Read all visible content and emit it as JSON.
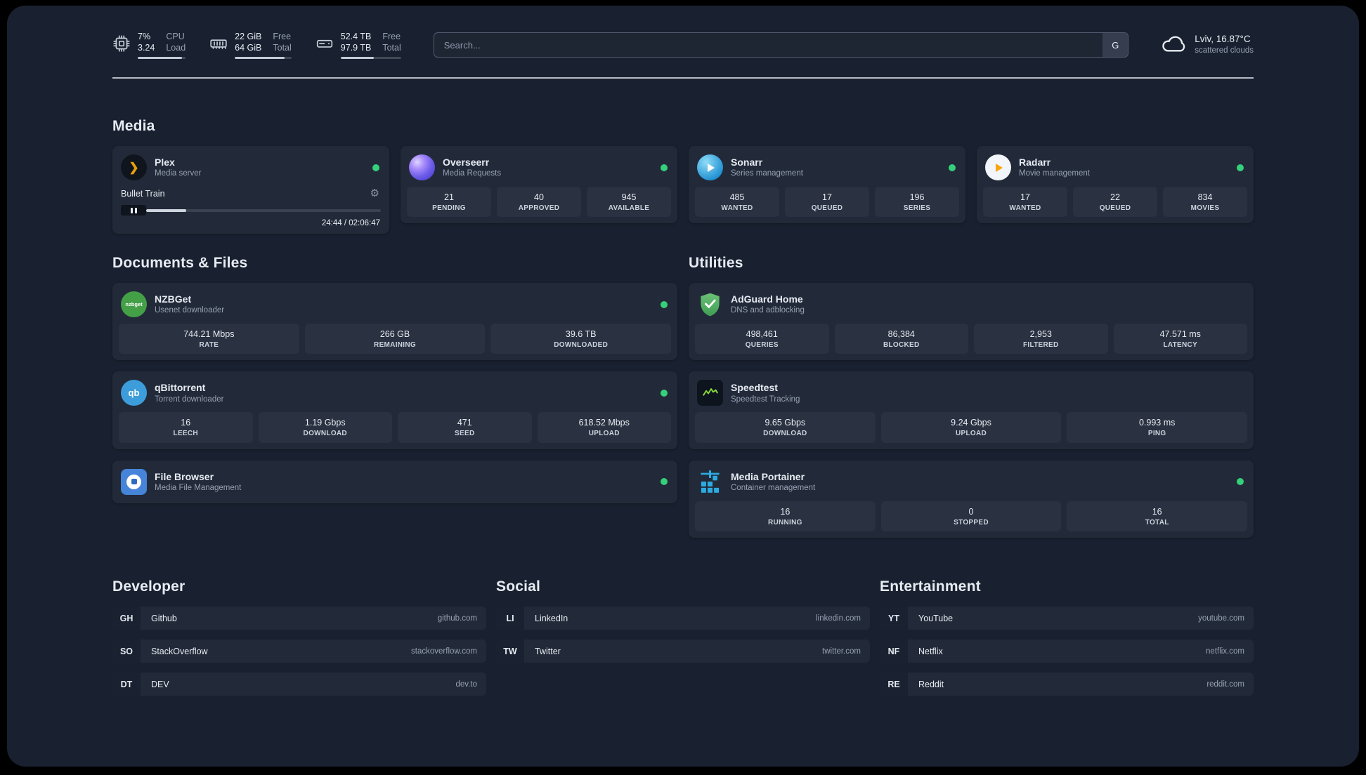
{
  "colors": {
    "page-bg": "#192130",
    "card-bg": "#222a39",
    "stat-bg": "#2a3140",
    "abbr-bg": "#1a2130",
    "text-primary": "#e7ebf2",
    "text-secondary": "#97a1b3",
    "status-online": "#35d07a",
    "plex-amber": "#e5a00d",
    "search-border": "#525b6e"
  },
  "icons": {
    "plex_glyph": "❯",
    "gear": "⚙"
  },
  "topbar": {
    "cpu": {
      "percent": "7%",
      "load": "3.24",
      "label_top": "CPU",
      "label_bottom": "Load"
    },
    "memory": {
      "free": "22 GiB",
      "total": "64 GiB",
      "label_top": "Free",
      "label_bottom": "Total"
    },
    "disk": {
      "free": "52.4 TB",
      "total": "97.9 TB",
      "label_top": "Free",
      "label_bottom": "Total"
    },
    "search": {
      "placeholder": "Search...",
      "provider": "G"
    },
    "weather": {
      "location": "Lviv, 16.87°C",
      "condition": "scattered clouds"
    }
  },
  "sections": {
    "media": "Media",
    "documents": "Documents & Files",
    "utilities": "Utilities",
    "developer": "Developer",
    "social": "Social",
    "entertainment": "Entertainment"
  },
  "services": {
    "plex": {
      "name": "Plex",
      "desc": "Media server",
      "now_playing": "Bullet Train",
      "time": "24:44 / 02:06:47"
    },
    "overseerr": {
      "name": "Overseerr",
      "desc": "Media Requests",
      "stats": [
        {
          "value": "21",
          "label": "PENDING"
        },
        {
          "value": "40",
          "label": "APPROVED"
        },
        {
          "value": "945",
          "label": "AVAILABLE"
        }
      ]
    },
    "sonarr": {
      "name": "Sonarr",
      "desc": "Series management",
      "stats": [
        {
          "value": "485",
          "label": "WANTED"
        },
        {
          "value": "17",
          "label": "QUEUED"
        },
        {
          "value": "196",
          "label": "SERIES"
        }
      ]
    },
    "radarr": {
      "name": "Radarr",
      "desc": "Movie management",
      "stats": [
        {
          "value": "17",
          "label": "WANTED"
        },
        {
          "value": "22",
          "label": "QUEUED"
        },
        {
          "value": "834",
          "label": "MOVIES"
        }
      ]
    },
    "nzbget": {
      "name": "NZBGet",
      "desc": "Usenet downloader",
      "icon_text": "nzbget",
      "stats": [
        {
          "value": "744.21 Mbps",
          "label": "RATE"
        },
        {
          "value": "266 GB",
          "label": "REMAINING"
        },
        {
          "value": "39.6 TB",
          "label": "DOWNLOADED"
        }
      ]
    },
    "qbittorrent": {
      "name": "qBittorrent",
      "desc": "Torrent downloader",
      "icon_text": "qb",
      "stats": [
        {
          "value": "16",
          "label": "LEECH"
        },
        {
          "value": "1.19 Gbps",
          "label": "DOWNLOAD"
        },
        {
          "value": "471",
          "label": "SEED"
        },
        {
          "value": "618.52 Mbps",
          "label": "UPLOAD"
        }
      ]
    },
    "filebrowser": {
      "name": "File Browser",
      "desc": "Media File Management"
    },
    "adguard": {
      "name": "AdGuard Home",
      "desc": "DNS and adblocking",
      "stats": [
        {
          "value": "498,461",
          "label": "QUERIES"
        },
        {
          "value": "86,384",
          "label": "BLOCKED"
        },
        {
          "value": "2,953",
          "label": "FILTERED"
        },
        {
          "value": "47.571 ms",
          "label": "LATENCY"
        }
      ]
    },
    "speedtest": {
      "name": "Speedtest",
      "desc": "Speedtest Tracking",
      "stats": [
        {
          "value": "9.65 Gbps",
          "label": "DOWNLOAD"
        },
        {
          "value": "9.24 Gbps",
          "label": "UPLOAD"
        },
        {
          "value": "0.993 ms",
          "label": "PING"
        }
      ]
    },
    "portainer": {
      "name": "Media Portainer",
      "desc": "Container management",
      "stats": [
        {
          "value": "16",
          "label": "RUNNING"
        },
        {
          "value": "0",
          "label": "STOPPED"
        },
        {
          "value": "16",
          "label": "TOTAL"
        }
      ]
    }
  },
  "bookmarks": {
    "developer": [
      {
        "abbr": "GH",
        "name": "Github",
        "domain": "github.com"
      },
      {
        "abbr": "SO",
        "name": "StackOverflow",
        "domain": "stackoverflow.com"
      },
      {
        "abbr": "DT",
        "name": "DEV",
        "domain": "dev.to"
      }
    ],
    "social": [
      {
        "abbr": "LI",
        "name": "LinkedIn",
        "domain": "linkedin.com"
      },
      {
        "abbr": "TW",
        "name": "Twitter",
        "domain": "twitter.com"
      }
    ],
    "entertainment": [
      {
        "abbr": "YT",
        "name": "YouTube",
        "domain": "youtube.com"
      },
      {
        "abbr": "NF",
        "name": "Netflix",
        "domain": "netflix.com"
      },
      {
        "abbr": "RE",
        "name": "Reddit",
        "domain": "reddit.com"
      }
    ]
  }
}
